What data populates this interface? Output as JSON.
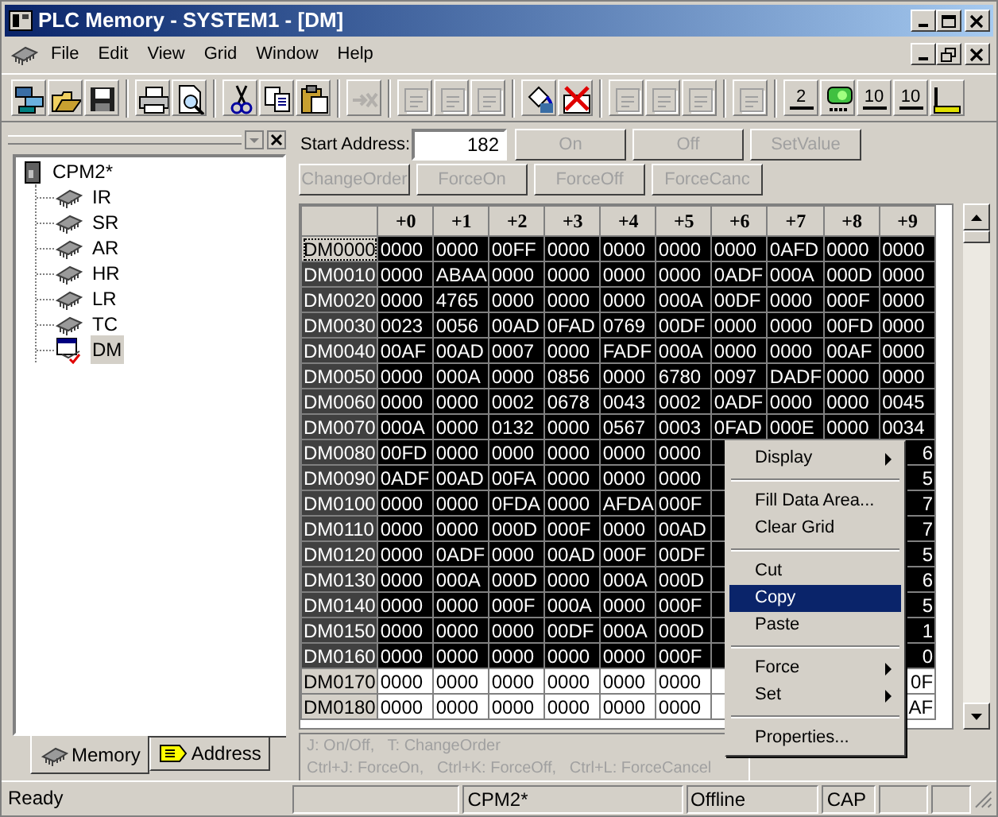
{
  "window": {
    "title": "PLC Memory - SYSTEM1 - [DM]"
  },
  "menu": [
    "File",
    "Edit",
    "View",
    "Grid",
    "Window",
    "Help"
  ],
  "toolbar": [
    [
      {
        "kind": "windows",
        "disabled": false
      },
      {
        "kind": "open",
        "disabled": false
      },
      {
        "kind": "save",
        "disabled": false
      }
    ],
    [
      {
        "kind": "print",
        "disabled": false
      },
      {
        "kind": "preview",
        "disabled": false
      }
    ],
    [
      {
        "kind": "cut",
        "disabled": false
      },
      {
        "kind": "copy",
        "disabled": false
      },
      {
        "kind": "paste",
        "disabled": false
      }
    ],
    [
      {
        "kind": "clear",
        "disabled": true
      }
    ],
    [
      {
        "kind": "doc",
        "disabled": true
      },
      {
        "kind": "doc",
        "disabled": true
      },
      {
        "kind": "doc",
        "disabled": true
      }
    ],
    [
      {
        "kind": "fill",
        "disabled": false
      },
      {
        "kind": "delete",
        "disabled": false
      }
    ],
    [
      {
        "kind": "doc",
        "disabled": true
      },
      {
        "kind": "doc",
        "disabled": true
      },
      {
        "kind": "doc",
        "disabled": true
      }
    ],
    [
      {
        "kind": "doc",
        "disabled": true
      }
    ],
    [
      {
        "kind": "num",
        "label": "2",
        "disabled": false
      },
      {
        "kind": "green",
        "disabled": false
      },
      {
        "kind": "num",
        "label": "10",
        "disabled": false
      },
      {
        "kind": "num",
        "label": "10",
        "disabled": false
      },
      {
        "kind": "meter",
        "disabled": false
      }
    ]
  ],
  "tree": {
    "label": "CPM2*",
    "children": [
      {
        "label": "IR",
        "kind": "chip",
        "selected": false
      },
      {
        "label": "SR",
        "kind": "chip",
        "selected": false
      },
      {
        "label": "AR",
        "kind": "chip",
        "selected": false
      },
      {
        "label": "HR",
        "kind": "chip",
        "selected": false
      },
      {
        "label": "LR",
        "kind": "chip",
        "selected": false
      },
      {
        "label": "TC",
        "kind": "chip",
        "selected": false
      },
      {
        "label": "DM",
        "kind": "table",
        "selected": true
      }
    ]
  },
  "panel_tabs": [
    {
      "label": "Memory",
      "kind": "chip",
      "selected": true
    },
    {
      "label": "Address",
      "kind": "tag",
      "selected": false
    }
  ],
  "start_address": {
    "label": "Start Address:",
    "value": "182"
  },
  "buttons": [
    [
      {
        "label": "On",
        "disabled": true
      },
      {
        "label": "Off",
        "disabled": true
      },
      {
        "label": "SetValue",
        "disabled": true
      }
    ],
    [
      {
        "label": "ChangeOrder",
        "disabled": true
      },
      {
        "label": "ForceOn",
        "disabled": true
      },
      {
        "label": "ForceOff",
        "disabled": true
      },
      {
        "label": "ForceCanc",
        "disabled": true
      }
    ]
  ],
  "grid": {
    "columns": [
      "+0",
      "+1",
      "+2",
      "+3",
      "+4",
      "+5",
      "+6",
      "+7",
      "+8",
      "+9"
    ],
    "rows": [
      {
        "address": "DM0000",
        "selected": true,
        "focused": true,
        "cells": [
          "0000",
          "0000",
          "00FF",
          "0000",
          "0000",
          "0000",
          "0000",
          "0AFD",
          "0000",
          "0000"
        ]
      },
      {
        "address": "DM0010",
        "selected": true,
        "focused": false,
        "cells": [
          "0000",
          "ABAA",
          "0000",
          "0000",
          "0000",
          "0000",
          "0ADF",
          "000A",
          "000D",
          "0000"
        ]
      },
      {
        "address": "DM0020",
        "selected": true,
        "focused": false,
        "cells": [
          "0000",
          "4765",
          "0000",
          "0000",
          "0000",
          "000A",
          "00DF",
          "0000",
          "000F",
          "0000"
        ]
      },
      {
        "address": "DM0030",
        "selected": true,
        "focused": false,
        "cells": [
          "0023",
          "0056",
          "00AD",
          "0FAD",
          "0769",
          "00DF",
          "0000",
          "0000",
          "00FD",
          "0000"
        ]
      },
      {
        "address": "DM0040",
        "selected": true,
        "focused": false,
        "cells": [
          "00AF",
          "00AD",
          "0007",
          "0000",
          "FADF",
          "000A",
          "0000",
          "0000",
          "00AF",
          "0000"
        ]
      },
      {
        "address": "DM0050",
        "selected": true,
        "focused": false,
        "cells": [
          "0000",
          "000A",
          "0000",
          "0856",
          "0000",
          "6780",
          "0097",
          "DADF",
          "0000",
          "0000"
        ]
      },
      {
        "address": "DM0060",
        "selected": true,
        "focused": false,
        "cells": [
          "0000",
          "0000",
          "0002",
          "0678",
          "0043",
          "0002",
          "0ADF",
          "0000",
          "0000",
          "0045"
        ]
      },
      {
        "address": "DM0070",
        "selected": true,
        "focused": false,
        "cells": [
          "000A",
          "0000",
          "0132",
          "0000",
          "0567",
          "0003",
          "0FAD",
          "000E",
          "0000",
          "0034"
        ]
      },
      {
        "address": "DM0080",
        "selected": true,
        "focused": false,
        "cells": [
          "00FD",
          "0000",
          "0000",
          "0000",
          "0000",
          "0000",
          null,
          null,
          null,
          "6"
        ]
      },
      {
        "address": "DM0090",
        "selected": true,
        "focused": false,
        "cells": [
          "0ADF",
          "00AD",
          "00FA",
          "0000",
          "0000",
          "0000",
          null,
          null,
          null,
          "5"
        ]
      },
      {
        "address": "DM0100",
        "selected": true,
        "focused": false,
        "cells": [
          "0000",
          "0000",
          "0FDA",
          "0000",
          "AFDA",
          "000F",
          null,
          null,
          null,
          "7"
        ]
      },
      {
        "address": "DM0110",
        "selected": true,
        "focused": false,
        "cells": [
          "0000",
          "0000",
          "000D",
          "000F",
          "0000",
          "00AD",
          null,
          null,
          null,
          "7"
        ]
      },
      {
        "address": "DM0120",
        "selected": true,
        "focused": false,
        "cells": [
          "0000",
          "0ADF",
          "0000",
          "00AD",
          "000F",
          "00DF",
          null,
          null,
          null,
          "5"
        ]
      },
      {
        "address": "DM0130",
        "selected": true,
        "focused": false,
        "cells": [
          "0000",
          "000A",
          "000D",
          "0000",
          "000A",
          "000D",
          null,
          null,
          null,
          "6"
        ]
      },
      {
        "address": "DM0140",
        "selected": true,
        "focused": false,
        "cells": [
          "0000",
          "0000",
          "000F",
          "000A",
          "0000",
          "000F",
          null,
          null,
          null,
          "5"
        ]
      },
      {
        "address": "DM0150",
        "selected": true,
        "focused": false,
        "cells": [
          "0000",
          "0000",
          "0000",
          "00DF",
          "000A",
          "000D",
          null,
          null,
          null,
          "1"
        ]
      },
      {
        "address": "DM0160",
        "selected": true,
        "focused": false,
        "cells": [
          "0000",
          "0000",
          "0000",
          "0000",
          "0000",
          "000F",
          null,
          null,
          null,
          "0"
        ]
      },
      {
        "address": "DM0170",
        "selected": false,
        "focused": false,
        "cells": [
          "0000",
          "0000",
          "0000",
          "0000",
          "0000",
          "0000",
          null,
          null,
          null,
          "0F"
        ]
      },
      {
        "address": "DM0180",
        "selected": false,
        "focused": false,
        "cells": [
          "0000",
          "0000",
          "0000",
          "0000",
          "0000",
          "0000",
          null,
          null,
          null,
          "AF"
        ]
      }
    ]
  },
  "hints": [
    "J: On/Off,   T: ChangeOrder",
    "Ctrl+J: ForceOn,   Ctrl+K: ForceOff,   Ctrl+L: ForceCancel"
  ],
  "context_menu": [
    {
      "kind": "item",
      "label": "Display",
      "submenu": true,
      "selected": false
    },
    {
      "kind": "separator"
    },
    {
      "kind": "item",
      "label": "Fill Data Area...",
      "submenu": false,
      "selected": false
    },
    {
      "kind": "item",
      "label": "Clear Grid",
      "submenu": false,
      "selected": false
    },
    {
      "kind": "separator"
    },
    {
      "kind": "item",
      "label": "Cut",
      "submenu": false,
      "selected": false
    },
    {
      "kind": "item",
      "label": "Copy",
      "submenu": false,
      "selected": true
    },
    {
      "kind": "item",
      "label": "Paste",
      "submenu": false,
      "selected": false
    },
    {
      "kind": "separator"
    },
    {
      "kind": "item",
      "label": "Force",
      "submenu": true,
      "selected": false
    },
    {
      "kind": "item",
      "label": "Set",
      "submenu": true,
      "selected": false
    },
    {
      "kind": "separator"
    },
    {
      "kind": "item",
      "label": "Properties...",
      "submenu": false,
      "selected": false
    }
  ],
  "status_bar": [
    "Ready",
    "CPM2*",
    "Offline",
    "CAP"
  ]
}
